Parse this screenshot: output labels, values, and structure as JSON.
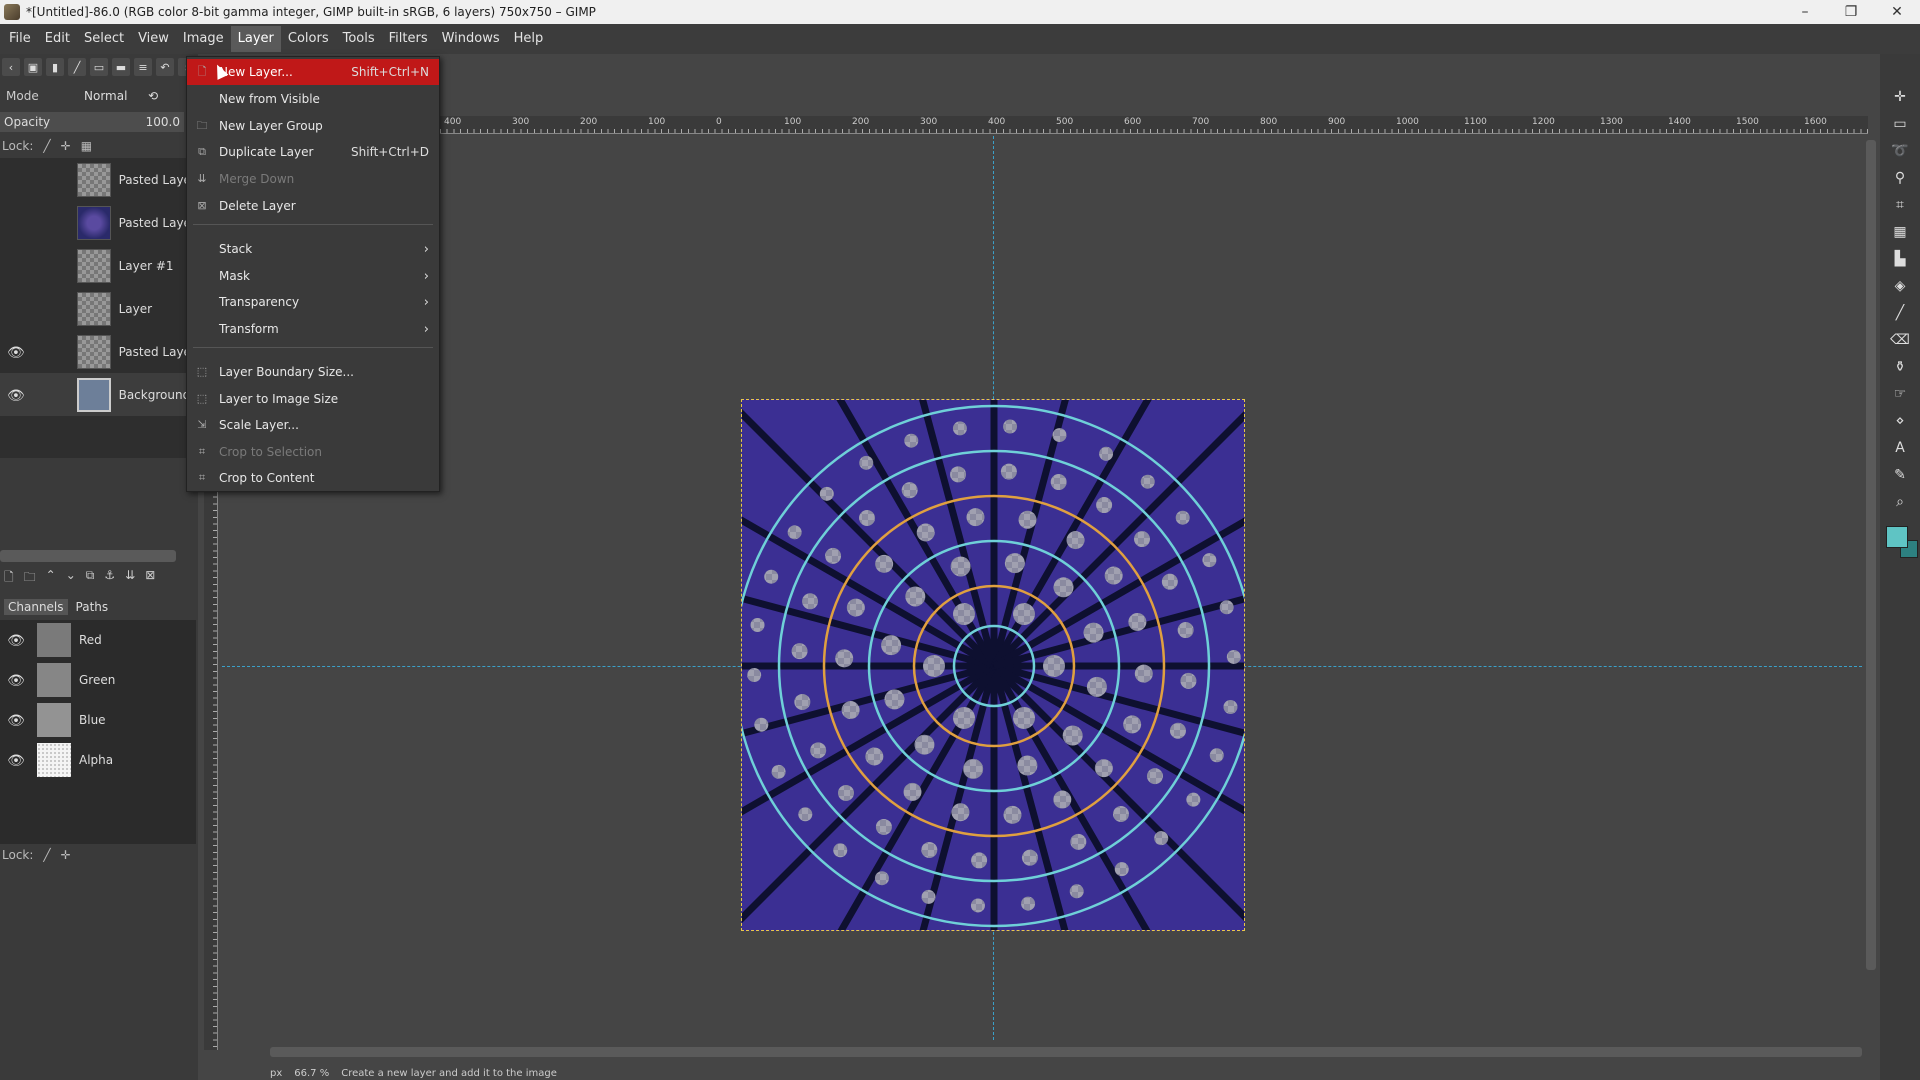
{
  "titlebar": {
    "title": "*[Untitled]-86.0 (RGB color 8-bit gamma integer, GIMP built-in sRGB, 6 layers) 750x750 – GIMP",
    "min": "–",
    "max": "❐",
    "close": "✕"
  },
  "menubar": [
    "File",
    "Edit",
    "Select",
    "View",
    "Image",
    "Layer",
    "Colors",
    "Tools",
    "Filters",
    "Windows",
    "Help"
  ],
  "layers_panel": {
    "mode_label": "Mode",
    "mode_value": "Normal",
    "opacity_label": "Opacity",
    "opacity_value": "100.0",
    "lock_label": "Lock:",
    "layers": [
      {
        "name": "Pasted Layer",
        "visible": false
      },
      {
        "name": "Pasted Layer",
        "visible": false
      },
      {
        "name": "Layer #1",
        "visible": false
      },
      {
        "name": "Layer",
        "visible": false
      },
      {
        "name": "Pasted Layer",
        "visible": true
      },
      {
        "name": "Background",
        "visible": true
      }
    ]
  },
  "channels_panel": {
    "tab_channels": "Channels",
    "tab_paths": "Paths",
    "lock_label": "Lock:",
    "channels": [
      "Red",
      "Green",
      "Blue",
      "Alpha"
    ]
  },
  "layer_menu": {
    "new_layer": {
      "label": "New Layer...",
      "shortcut": "Shift+Ctrl+N"
    },
    "new_from_visible": {
      "label": "New from Visible"
    },
    "new_layer_group": {
      "label": "New Layer Group"
    },
    "duplicate_layer": {
      "label": "Duplicate Layer",
      "shortcut": "Shift+Ctrl+D"
    },
    "merge_down": {
      "label": "Merge Down"
    },
    "delete_layer": {
      "label": "Delete Layer"
    },
    "stack": {
      "label": "Stack"
    },
    "mask": {
      "label": "Mask"
    },
    "transparency": {
      "label": "Transparency"
    },
    "transform": {
      "label": "Transform"
    },
    "layer_boundary_size": {
      "label": "Layer Boundary Size..."
    },
    "layer_to_image_size": {
      "label": "Layer to Image Size"
    },
    "scale_layer": {
      "label": "Scale Layer..."
    },
    "crop_to_selection": {
      "label": "Crop to Selection"
    },
    "crop_to_content": {
      "label": "Crop to Content"
    }
  },
  "ruler_labels": [
    "400",
    "300",
    "200",
    "100",
    "0",
    "100",
    "200",
    "300",
    "400",
    "500",
    "600",
    "700",
    "800",
    "900",
    "1000",
    "1100",
    "1200",
    "1300",
    "1400",
    "1500",
    "1600"
  ],
  "status": {
    "unit": "px",
    "zoom": "66.7 %",
    "message": "Create a new layer and add it to the image"
  },
  "colors": {
    "menu_highlight": "#c01818",
    "foreground": "#5fc4c4",
    "background_color": "#2d8080",
    "guide": "#3aa0c8"
  }
}
